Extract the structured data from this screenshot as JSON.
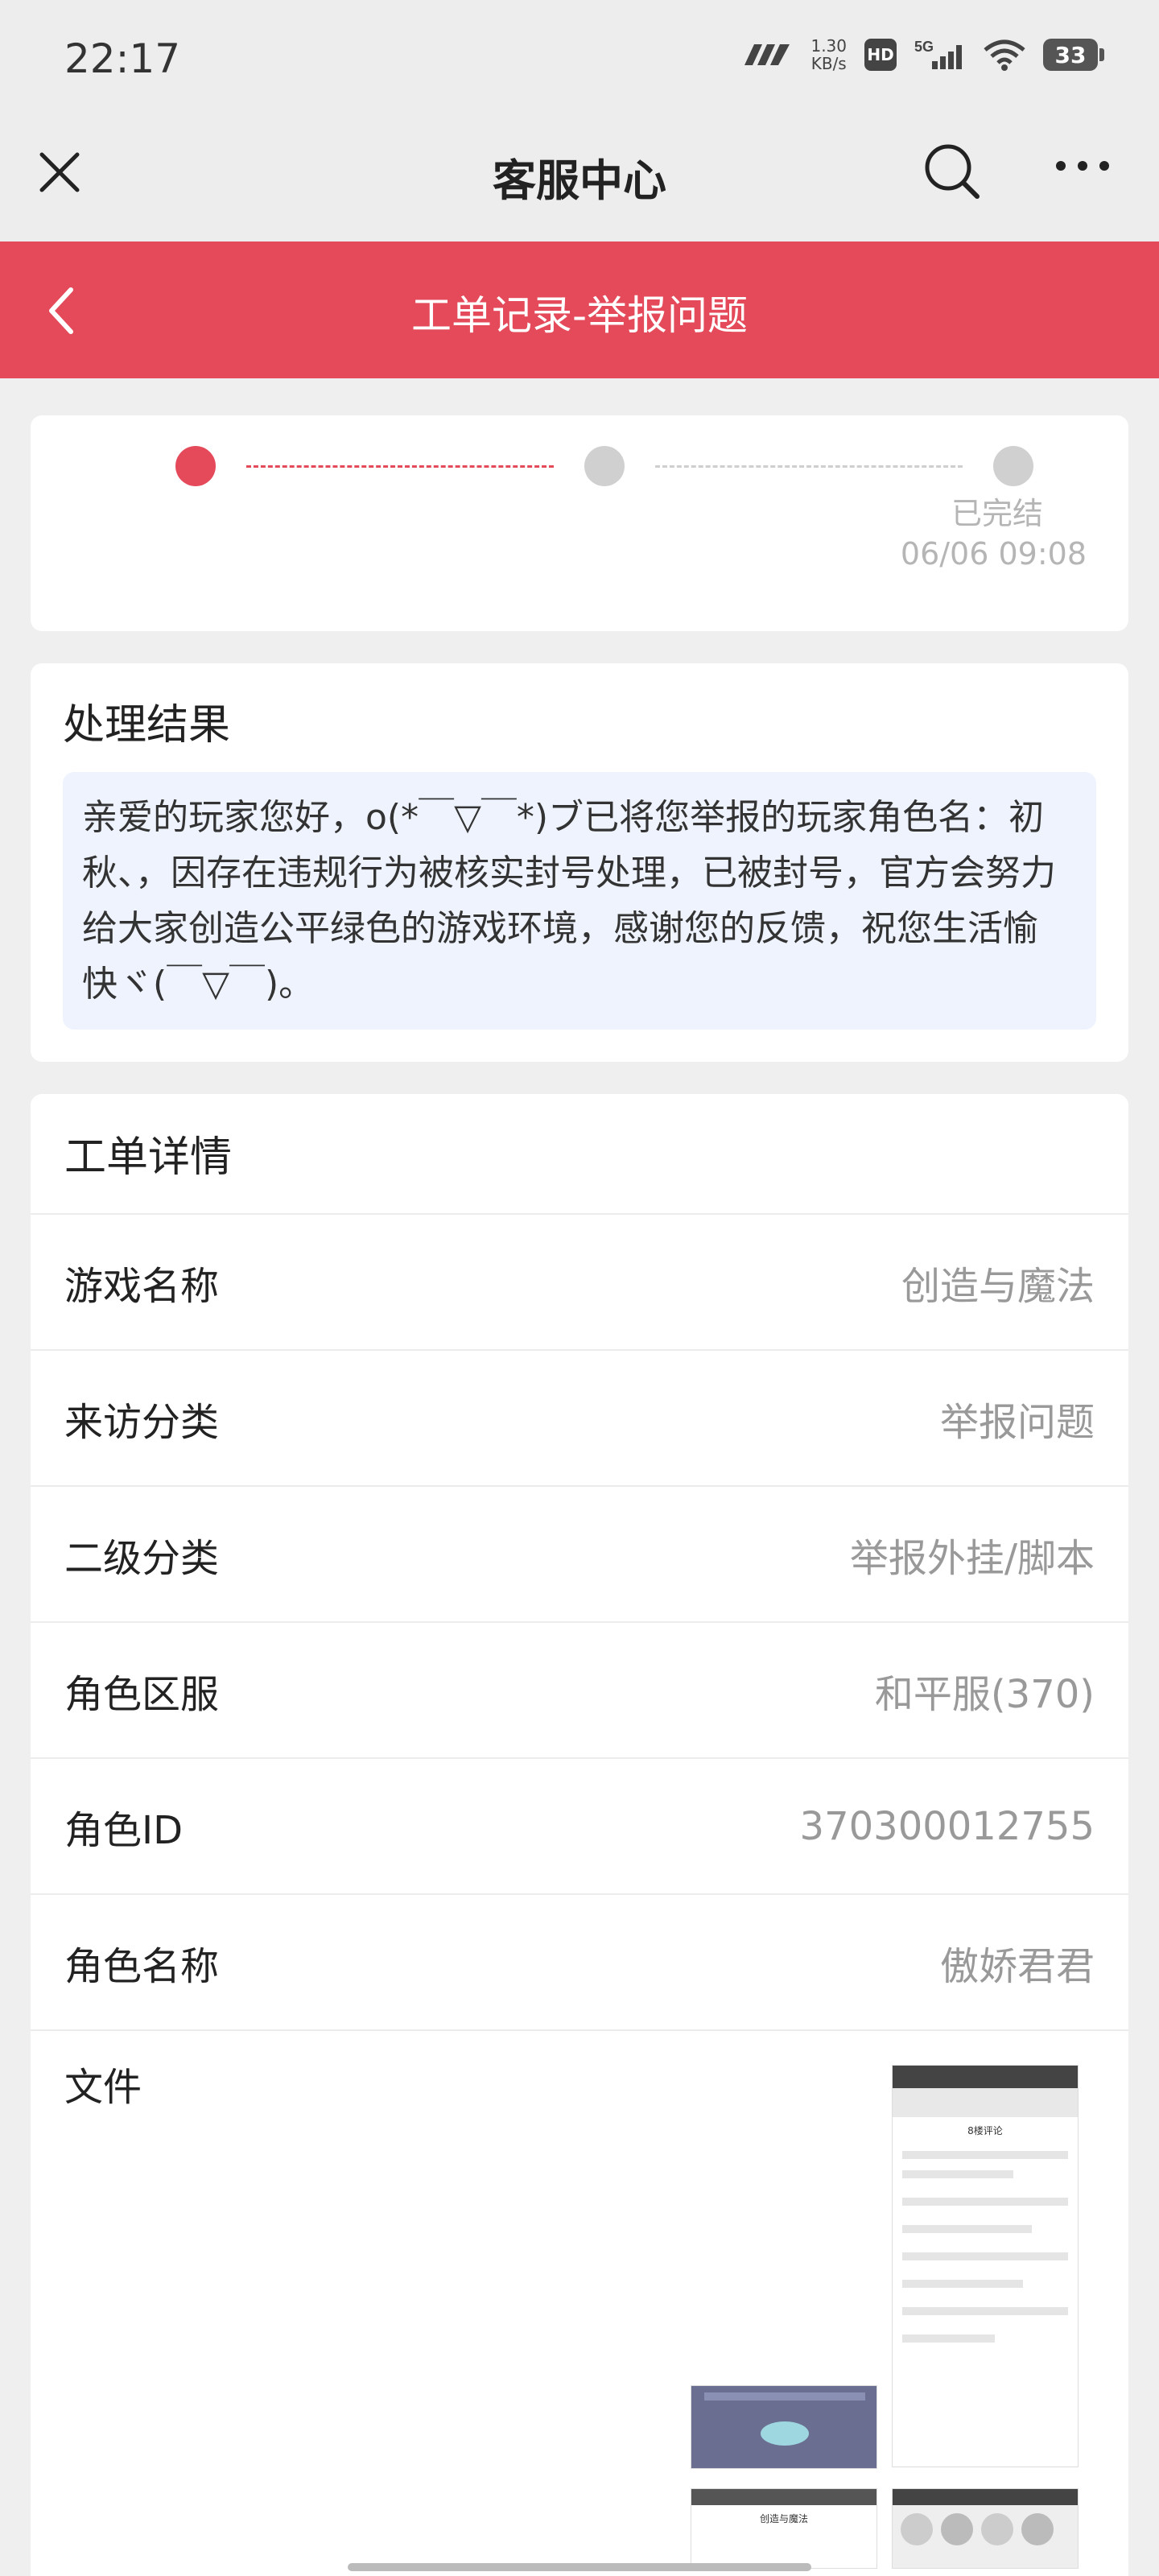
{
  "status_bar": {
    "time": "22:17",
    "speed_value": "1.30",
    "speed_unit": "KB/s",
    "hd": "HD",
    "network": "5G",
    "battery": "33"
  },
  "header": {
    "title": "客服中心"
  },
  "subheader": {
    "title": "工单记录-举报问题"
  },
  "progress": {
    "final_label": "已完结",
    "final_time": "06/06 09:08",
    "colors": {
      "active": "#e44a5a",
      "inactive": "#d0d0d0"
    }
  },
  "result": {
    "title": "处理结果",
    "text": "亲爱的玩家您好，o(*￣▽￣*)ブ已将您举报的玩家角色名：初秋、，因存在违规行为被核实封号处理，已被封号，官方会努力给大家创造公平绿色的游戏环境，感谢您的反馈，祝您生活愉快ヾ(￣▽￣)。"
  },
  "detail": {
    "title": "工单详情",
    "rows": [
      {
        "label": "游戏名称",
        "value": "创造与魔法"
      },
      {
        "label": "来访分类",
        "value": "举报问题"
      },
      {
        "label": "二级分类",
        "value": "举报外挂/脚本"
      },
      {
        "label": "角色区服",
        "value": "和平服(370)"
      },
      {
        "label": "角色ID",
        "value": "370300012755"
      },
      {
        "label": "角色名称",
        "value": "傲娇君君"
      }
    ],
    "file_label": "文件"
  },
  "thumbnail_text": {
    "t1_title": "8楼评论",
    "t3_title": "创造与魔法"
  }
}
